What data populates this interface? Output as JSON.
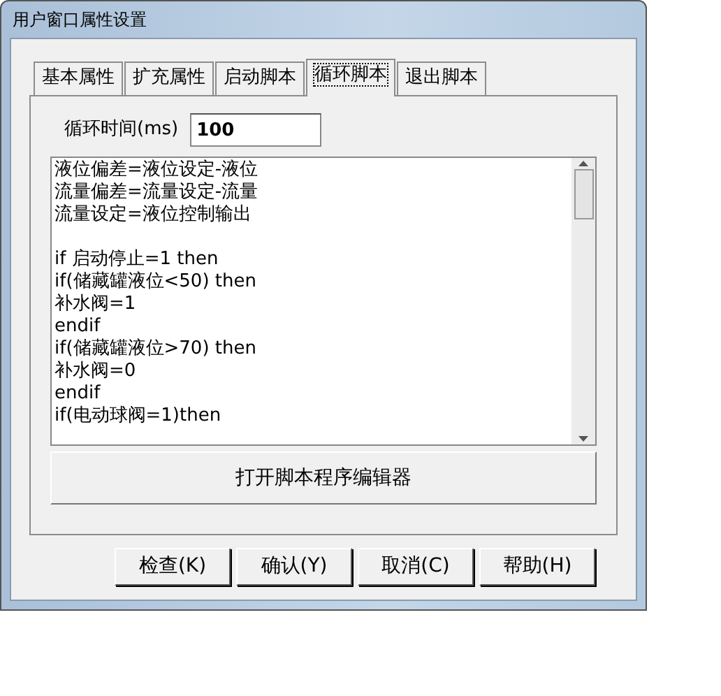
{
  "window": {
    "title": "用户窗口属性设置"
  },
  "tabs": [
    {
      "label": "基本属性",
      "selected": false
    },
    {
      "label": "扩充属性",
      "selected": false
    },
    {
      "label": "启动脚本",
      "selected": false
    },
    {
      "label": "循环脚本",
      "selected": true
    },
    {
      "label": "退出脚本",
      "selected": false
    }
  ],
  "cycle_time": {
    "label": "循环时间(ms)",
    "value": "100"
  },
  "script_lines": [
    {
      "kind": "code",
      "text": "液位偏差=液位设定-液位"
    },
    {
      "kind": "code",
      "text": "流量偏差=流量设定-流量"
    },
    {
      "kind": "code",
      "text": "流量设定=液位控制输出"
    },
    {
      "kind": "blank"
    },
    {
      "kind": "code",
      "text": "if 启动停止=1 then"
    },
    {
      "kind": "code",
      "text": "if(储藏罐液位<50) then"
    },
    {
      "kind": "code",
      "text": "补水阀=1"
    },
    {
      "kind": "code",
      "text": "endif"
    },
    {
      "kind": "code",
      "text": "if(储藏罐液位>70) then"
    },
    {
      "kind": "code",
      "text": "补水阀=0"
    },
    {
      "kind": "code",
      "text": "endif"
    },
    {
      "kind": "code",
      "text": "if(电动球阀=1)then"
    }
  ],
  "editor_button": "打开脚本程序编辑器",
  "buttons": [
    "检查(K)",
    "确认(Y)",
    "取消(C)",
    "帮助(H)"
  ]
}
